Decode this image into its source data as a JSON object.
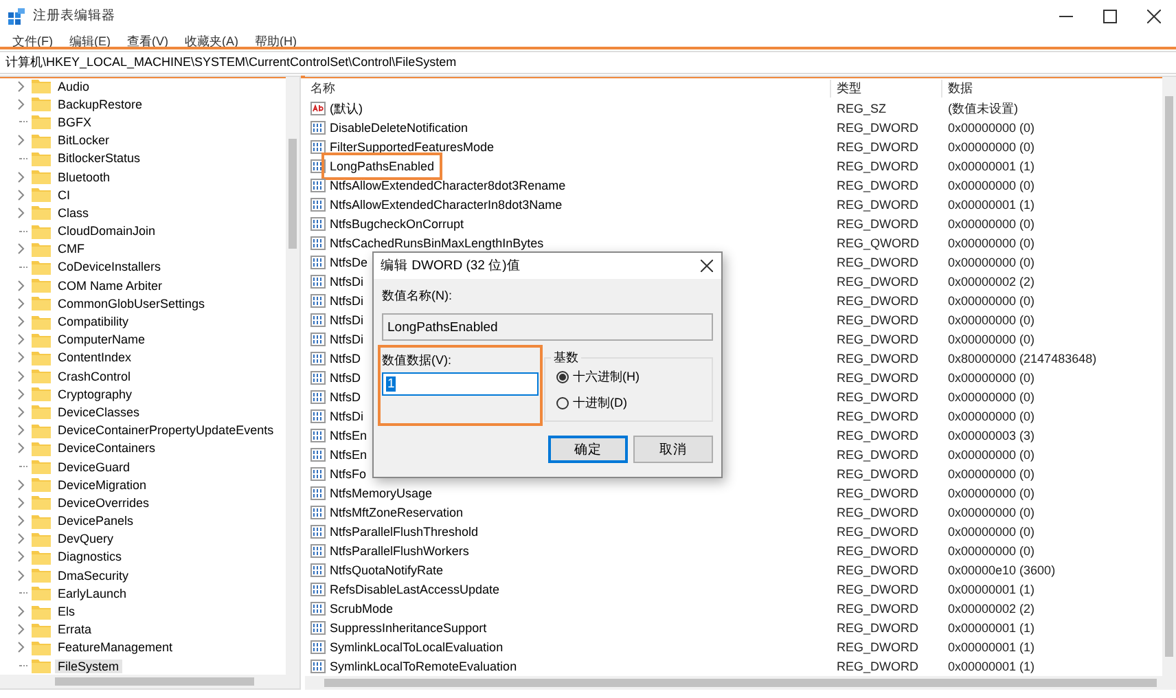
{
  "window": {
    "title": "注册表编辑器"
  },
  "menu": [
    "文件(F)",
    "编辑(E)",
    "查看(V)",
    "收藏夹(A)",
    "帮助(H)"
  ],
  "address": {
    "path": "计算机\\HKEY_LOCAL_MACHINE\\SYSTEM\\CurrentControlSet\\Control\\FileSystem",
    "highlighted": true
  },
  "tree": [
    {
      "label": "Audio",
      "expandable": true,
      "selected": false
    },
    {
      "label": "BackupRestore",
      "expandable": true,
      "selected": false
    },
    {
      "label": "BGFX",
      "expandable": false,
      "selected": false
    },
    {
      "label": "BitLocker",
      "expandable": true,
      "selected": false
    },
    {
      "label": "BitlockerStatus",
      "expandable": false,
      "selected": false
    },
    {
      "label": "Bluetooth",
      "expandable": true,
      "selected": false
    },
    {
      "label": "CI",
      "expandable": true,
      "selected": false
    },
    {
      "label": "Class",
      "expandable": true,
      "selected": false
    },
    {
      "label": "CloudDomainJoin",
      "expandable": false,
      "selected": false
    },
    {
      "label": "CMF",
      "expandable": true,
      "selected": false
    },
    {
      "label": "CoDeviceInstallers",
      "expandable": false,
      "selected": false
    },
    {
      "label": "COM Name Arbiter",
      "expandable": true,
      "selected": false
    },
    {
      "label": "CommonGlobUserSettings",
      "expandable": true,
      "selected": false
    },
    {
      "label": "Compatibility",
      "expandable": true,
      "selected": false
    },
    {
      "label": "ComputerName",
      "expandable": true,
      "selected": false
    },
    {
      "label": "ContentIndex",
      "expandable": true,
      "selected": false
    },
    {
      "label": "CrashControl",
      "expandable": true,
      "selected": false
    },
    {
      "label": "Cryptography",
      "expandable": true,
      "selected": false
    },
    {
      "label": "DeviceClasses",
      "expandable": true,
      "selected": false
    },
    {
      "label": "DeviceContainerPropertyUpdateEvents",
      "expandable": true,
      "selected": false
    },
    {
      "label": "DeviceContainers",
      "expandable": true,
      "selected": false
    },
    {
      "label": "DeviceGuard",
      "expandable": false,
      "selected": false
    },
    {
      "label": "DeviceMigration",
      "expandable": true,
      "selected": false
    },
    {
      "label": "DeviceOverrides",
      "expandable": true,
      "selected": false
    },
    {
      "label": "DevicePanels",
      "expandable": true,
      "selected": false
    },
    {
      "label": "DevQuery",
      "expandable": true,
      "selected": false
    },
    {
      "label": "Diagnostics",
      "expandable": true,
      "selected": false
    },
    {
      "label": "DmaSecurity",
      "expandable": true,
      "selected": false
    },
    {
      "label": "EarlyLaunch",
      "expandable": false,
      "selected": false
    },
    {
      "label": "Els",
      "expandable": true,
      "selected": false
    },
    {
      "label": "Errata",
      "expandable": true,
      "selected": false
    },
    {
      "label": "FeatureManagement",
      "expandable": true,
      "selected": false
    },
    {
      "label": "FileSystem",
      "expandable": false,
      "selected": true
    }
  ],
  "table": {
    "columns": [
      "名称",
      "类型",
      "数据"
    ],
    "rows": [
      {
        "kind": "string",
        "name": "(默认)",
        "type": "REG_SZ",
        "data": "(数值未设置)",
        "highlighted": false
      },
      {
        "kind": "number",
        "name": "DisableDeleteNotification",
        "type": "REG_DWORD",
        "data": "0x00000000 (0)",
        "highlighted": false
      },
      {
        "kind": "number",
        "name": "FilterSupportedFeaturesMode",
        "type": "REG_DWORD",
        "data": "0x00000000 (0)",
        "highlighted": false
      },
      {
        "kind": "number",
        "name": "LongPathsEnabled",
        "type": "REG_DWORD",
        "data": "0x00000001 (1)",
        "highlighted": true
      },
      {
        "kind": "number",
        "name": "NtfsAllowExtendedCharacter8dot3Rename",
        "type": "REG_DWORD",
        "data": "0x00000000 (0)",
        "highlighted": false
      },
      {
        "kind": "number",
        "name": "NtfsAllowExtendedCharacterIn8dot3Name",
        "type": "REG_DWORD",
        "data": "0x00000001 (1)",
        "highlighted": false
      },
      {
        "kind": "number",
        "name": "NtfsBugcheckOnCorrupt",
        "type": "REG_DWORD",
        "data": "0x00000000 (0)",
        "highlighted": false
      },
      {
        "kind": "number",
        "name": "NtfsCachedRunsBinMaxLengthInBytes",
        "type": "REG_QWORD",
        "data": "0x00000000 (0)",
        "highlighted": false
      },
      {
        "kind": "number",
        "name": "NtfsDe",
        "type": "REG_DWORD",
        "data": "0x00000000 (0)",
        "highlighted": false
      },
      {
        "kind": "number",
        "name": "NtfsDi",
        "type": "REG_DWORD",
        "data": "0x00000002 (2)",
        "highlighted": false
      },
      {
        "kind": "number",
        "name": "NtfsDi",
        "type": "REG_DWORD",
        "data": "0x00000000 (0)",
        "highlighted": false
      },
      {
        "kind": "number",
        "name": "NtfsDi",
        "type": "REG_DWORD",
        "data": "0x00000000 (0)",
        "highlighted": false
      },
      {
        "kind": "number",
        "name": "NtfsDi",
        "type": "REG_DWORD",
        "data": "0x00000000 (0)",
        "highlighted": false
      },
      {
        "kind": "number",
        "name": "NtfsD",
        "type": "REG_DWORD",
        "data": "0x80000000 (2147483648)",
        "highlighted": false
      },
      {
        "kind": "number",
        "name": "NtfsD",
        "type": "REG_DWORD",
        "data": "0x00000000 (0)",
        "highlighted": false
      },
      {
        "kind": "number",
        "name": "NtfsD",
        "type": "REG_DWORD",
        "data": "0x00000000 (0)",
        "highlighted": false
      },
      {
        "kind": "number",
        "name": "NtfsDi",
        "type": "REG_DWORD",
        "data": "0x00000000 (0)",
        "highlighted": false
      },
      {
        "kind": "number",
        "name": "NtfsEn",
        "type": "REG_DWORD",
        "data": "0x00000003 (3)",
        "highlighted": false
      },
      {
        "kind": "number",
        "name": "NtfsEn",
        "type": "REG_DWORD",
        "data": "0x00000000 (0)",
        "highlighted": false
      },
      {
        "kind": "number",
        "name": "NtfsFo",
        "type": "REG_DWORD",
        "data": "0x00000000 (0)",
        "highlighted": false
      },
      {
        "kind": "number",
        "name": "NtfsMemoryUsage",
        "type": "REG_DWORD",
        "data": "0x00000000 (0)",
        "highlighted": false
      },
      {
        "kind": "number",
        "name": "NtfsMftZoneReservation",
        "type": "REG_DWORD",
        "data": "0x00000000 (0)",
        "highlighted": false
      },
      {
        "kind": "number",
        "name": "NtfsParallelFlushThreshold",
        "type": "REG_DWORD",
        "data": "0x00000000 (0)",
        "highlighted": false
      },
      {
        "kind": "number",
        "name": "NtfsParallelFlushWorkers",
        "type": "REG_DWORD",
        "data": "0x00000000 (0)",
        "highlighted": false
      },
      {
        "kind": "number",
        "name": "NtfsQuotaNotifyRate",
        "type": "REG_DWORD",
        "data": "0x00000e10 (3600)",
        "highlighted": false
      },
      {
        "kind": "number",
        "name": "RefsDisableLastAccessUpdate",
        "type": "REG_DWORD",
        "data": "0x00000001 (1)",
        "highlighted": false
      },
      {
        "kind": "number",
        "name": "ScrubMode",
        "type": "REG_DWORD",
        "data": "0x00000002 (2)",
        "highlighted": false
      },
      {
        "kind": "number",
        "name": "SuppressInheritanceSupport",
        "type": "REG_DWORD",
        "data": "0x00000001 (1)",
        "highlighted": false
      },
      {
        "kind": "number",
        "name": "SymlinkLocalToLocalEvaluation",
        "type": "REG_DWORD",
        "data": "0x00000001 (1)",
        "highlighted": false
      },
      {
        "kind": "number",
        "name": "SymlinkLocalToRemoteEvaluation",
        "type": "REG_DWORD",
        "data": "0x00000001 (1)",
        "highlighted": false
      }
    ]
  },
  "dialog": {
    "title": "编辑 DWORD (32 位)值",
    "name_label": "数值名称(N):",
    "name_value": "LongPathsEnabled",
    "data_label": "数值数据(V):",
    "data_value": "1",
    "data_highlighted": true,
    "base_label": "基数",
    "radios": [
      {
        "label": "十六进制(H)",
        "selected": true
      },
      {
        "label": "十进制(D)",
        "selected": false
      }
    ],
    "buttons": [
      {
        "label": "确定",
        "default": true
      },
      {
        "label": "取消",
        "default": false
      }
    ]
  }
}
